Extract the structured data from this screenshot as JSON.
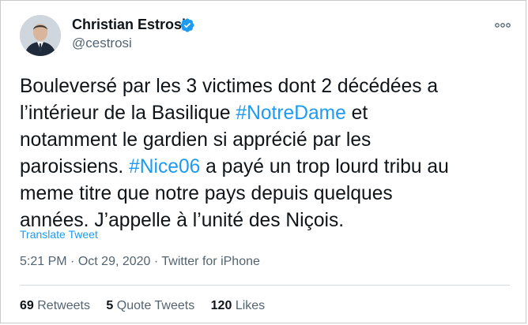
{
  "author": {
    "name": "Christian Estrosi",
    "handle": "@cestrosi",
    "verified": true
  },
  "tweet": {
    "lines": [
      [
        {
          "text": "Bouleversé par les 3 victimes dont 2 décédées a",
          "hashtag": false
        }
      ],
      [
        {
          "text": "l’intérieur de la Basilique ",
          "hashtag": false
        },
        {
          "text": "#NotreDame",
          "hashtag": true
        },
        {
          "text": " et",
          "hashtag": false
        }
      ],
      [
        {
          "text": "notamment le gardien si apprécié par les",
          "hashtag": false
        }
      ],
      [
        {
          "text": "paroissiens. ",
          "hashtag": false
        },
        {
          "text": "#Nice06",
          "hashtag": true
        },
        {
          "text": " a payé un trop lourd tribu au",
          "hashtag": false
        }
      ],
      [
        {
          "text": "meme titre que notre pays depuis quelques",
          "hashtag": false
        }
      ],
      [
        {
          "text": "années. J’appelle à l’unité des Niçois.",
          "hashtag": false
        }
      ]
    ],
    "translate_label": "Translate Tweet",
    "time": "5:21 PM",
    "separator": "·",
    "date": "Oct 29, 2020",
    "source": "Twitter for iPhone"
  },
  "stats": [
    {
      "count": "69",
      "label": "Retweets"
    },
    {
      "count": "5",
      "label": "Quote Tweets"
    },
    {
      "count": "120",
      "label": "Likes"
    }
  ],
  "icons": {
    "verified": "verified-badge-icon",
    "more": "more-options-icon"
  },
  "colors": {
    "link": "#1d9bf0",
    "verified": "#1d9bf0",
    "secondary_text": "#536471",
    "primary_text": "#0f1419"
  }
}
